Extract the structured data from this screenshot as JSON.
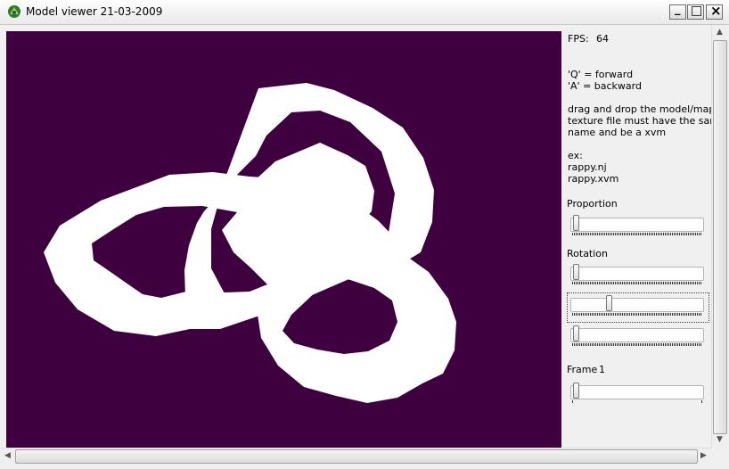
{
  "window": {
    "title": "Model viewer 21-03-2009",
    "minimize_glyph": "_",
    "maximize_glyph": "□",
    "close_glyph": "×"
  },
  "viewport": {
    "background_color": "#3f0040",
    "model_color": "#ffffff"
  },
  "panel": {
    "fps_label": "FPS:",
    "fps_value": "64",
    "help_forward": "'Q' = forward",
    "help_backward": "'A' = backward",
    "drop_line1": "drag and drop the model/map,",
    "drop_line2": "texture file must have the same",
    "drop_line3": "name and be a xvm",
    "example_label": "ex:",
    "example_file1": "rappy.nj",
    "example_file2": "rappy.xvm",
    "proportion_label": "Proportion",
    "proportion_value": 0.02,
    "rotation_label": "Rotation",
    "rotation_x_value": 0.02,
    "rotation_y_value": 0.27,
    "rotation_z_value": 0.02,
    "frame_label": "Frame",
    "frame_value": "1",
    "frame_slider_value": 0.02
  },
  "scrollbars": {
    "up_arrow": "▲",
    "down_arrow": "▼",
    "left_arrow": "◀",
    "right_arrow": "▶"
  },
  "icons": {
    "app": "model-viewer-app-icon",
    "minimize": "minimize-icon",
    "maximize": "maximize-icon",
    "close": "close-icon"
  }
}
